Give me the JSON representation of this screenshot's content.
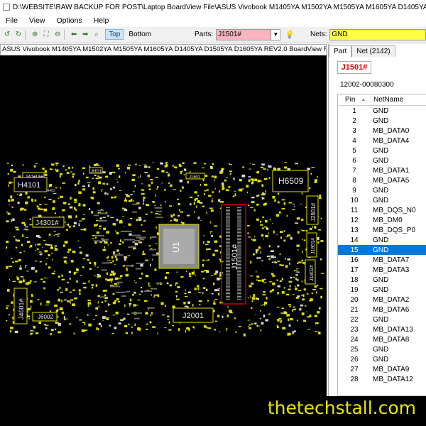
{
  "window": {
    "title": "D:\\WEBSITE\\RAW BACKUP FOR POST\\Laptop BoardView File\\ASUS Vivobook M1405YA M1502YA M1505YA M1605YA D1405YA D1505YA D1605YA Boar"
  },
  "menu": [
    "File",
    "View",
    "Options",
    "Help"
  ],
  "toolbar": {
    "top_label": "Top",
    "bottom_label": "Bottom",
    "parts_label": "Parts:",
    "parts_value": "J1501#",
    "nets_label": "Nets:",
    "nets_value": "GND"
  },
  "board_tab": {
    "label": "ASUS Vivobook M1405YA M1502YA M1505YA M1605YA D1405YA D1505YA D1605YA REV2.0 BoardView F"
  },
  "board_labels": {
    "h4101": "H4101",
    "j4103": "J4103#",
    "h6509": "H6509",
    "j4301": "J4301#",
    "j4601": "J4601#",
    "j6002": "J6002",
    "j2001": "J2001",
    "u1": "U1",
    "j1501": "J1501#",
    "j2801": "J2801#",
    "j1801": "J1801#",
    "j1802": "J1802#",
    "j1601": "J1601",
    "jhd1": "JHD1",
    "tiny": "J4403"
  },
  "panel": {
    "tab_part": "Part",
    "tab_net": "Net (2142)",
    "part_name": "J1501#",
    "part_number": "12002-00080300",
    "col_pin": "Pin",
    "col_netname": "NetName",
    "rows": [
      {
        "pin": "1",
        "net": "GND"
      },
      {
        "pin": "2",
        "net": "GND"
      },
      {
        "pin": "3",
        "net": "MB_DATA0"
      },
      {
        "pin": "4",
        "net": "MB_DATA4"
      },
      {
        "pin": "5",
        "net": "GND"
      },
      {
        "pin": "6",
        "net": "GND"
      },
      {
        "pin": "7",
        "net": "MB_DATA1"
      },
      {
        "pin": "8",
        "net": "MB_DATA5"
      },
      {
        "pin": "9",
        "net": "GND"
      },
      {
        "pin": "10",
        "net": "GND"
      },
      {
        "pin": "11",
        "net": "MB_DQS_N0"
      },
      {
        "pin": "12",
        "net": "MB_DM0"
      },
      {
        "pin": "13",
        "net": "MB_DQS_P0"
      },
      {
        "pin": "14",
        "net": "GND"
      },
      {
        "pin": "15",
        "net": "GND"
      },
      {
        "pin": "16",
        "net": "MB_DATA7"
      },
      {
        "pin": "17",
        "net": "MB_DATA3"
      },
      {
        "pin": "18",
        "net": "GND"
      },
      {
        "pin": "19",
        "net": "GND"
      },
      {
        "pin": "20",
        "net": "MB_DATA2"
      },
      {
        "pin": "21",
        "net": "MB_DATA6"
      },
      {
        "pin": "22",
        "net": "GND"
      },
      {
        "pin": "23",
        "net": "MB_DATA13"
      },
      {
        "pin": "24",
        "net": "MB_DATA8"
      },
      {
        "pin": "25",
        "net": "GND"
      },
      {
        "pin": "26",
        "net": "GND"
      },
      {
        "pin": "27",
        "net": "MB_DATA9"
      },
      {
        "pin": "28",
        "net": "MB_DATA12"
      }
    ],
    "selected_index": 14
  },
  "watermark": "thetechstall.com",
  "colors": {
    "board_bg": "#000000",
    "component": "#e0e000",
    "highlight": "#d00000",
    "selection": "#0078d7",
    "parts_field": "#f9b4c0",
    "nets_field": "#ffff44"
  }
}
